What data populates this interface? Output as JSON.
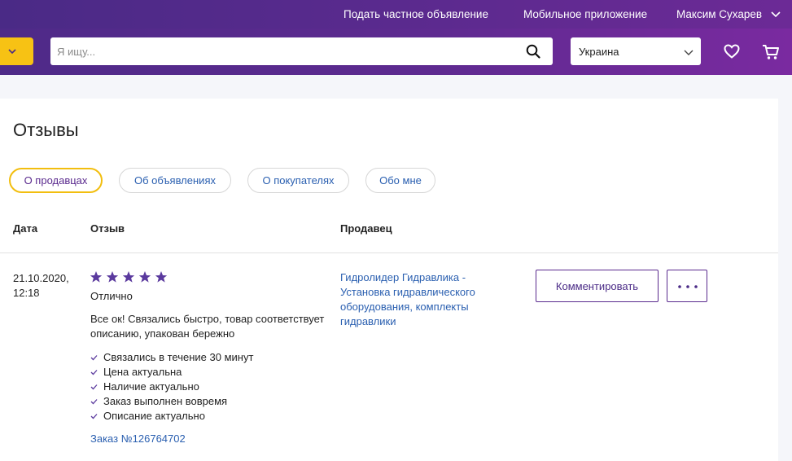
{
  "header": {
    "post_ad": "Подать частное объявление",
    "mobile_app": "Мобильное приложение",
    "user_name": "Максим Сухарев"
  },
  "search": {
    "placeholder": "Я ищу...",
    "value": "",
    "region": "Украина"
  },
  "page": {
    "title": "Отзывы"
  },
  "tabs": [
    {
      "label": "О продавцах",
      "active": true
    },
    {
      "label": "Об объявлениях",
      "active": false
    },
    {
      "label": "О покупателях",
      "active": false
    },
    {
      "label": "Обо мне",
      "active": false
    }
  ],
  "table": {
    "headers": {
      "date": "Дата",
      "review": "Отзыв",
      "seller": "Продавец"
    },
    "rows": [
      {
        "date": "21.10.2020, 12:18",
        "rating": 5,
        "rating_label": "Отлично",
        "text": "Все ок! Связались быстро, товар соответствует описанию, упакован бережно",
        "checks": [
          "Связались в течение 30 минут",
          "Цена актуальна",
          "Наличие актуально",
          "Заказ выполнен вовремя",
          "Описание актуально"
        ],
        "order": "Заказ №126764702",
        "seller": "Гидролидер Гидравлика - Установка гидравлического оборудования, комплекты гидравлики",
        "comment_label": "Комментировать"
      }
    ]
  },
  "colors": {
    "brand_purple": "#5a2a8e",
    "accent_yellow": "#f7c214",
    "link_blue": "#2a5fb0",
    "star_purple": "#5b3a9e"
  },
  "icons": {
    "catalog": "chevron-down-icon",
    "search": "search-icon",
    "region": "chevron-down-icon",
    "favorites": "heart-icon",
    "cart": "cart-icon",
    "more": "more-dots-icon",
    "check": "check-icon",
    "star": "star-icon"
  }
}
